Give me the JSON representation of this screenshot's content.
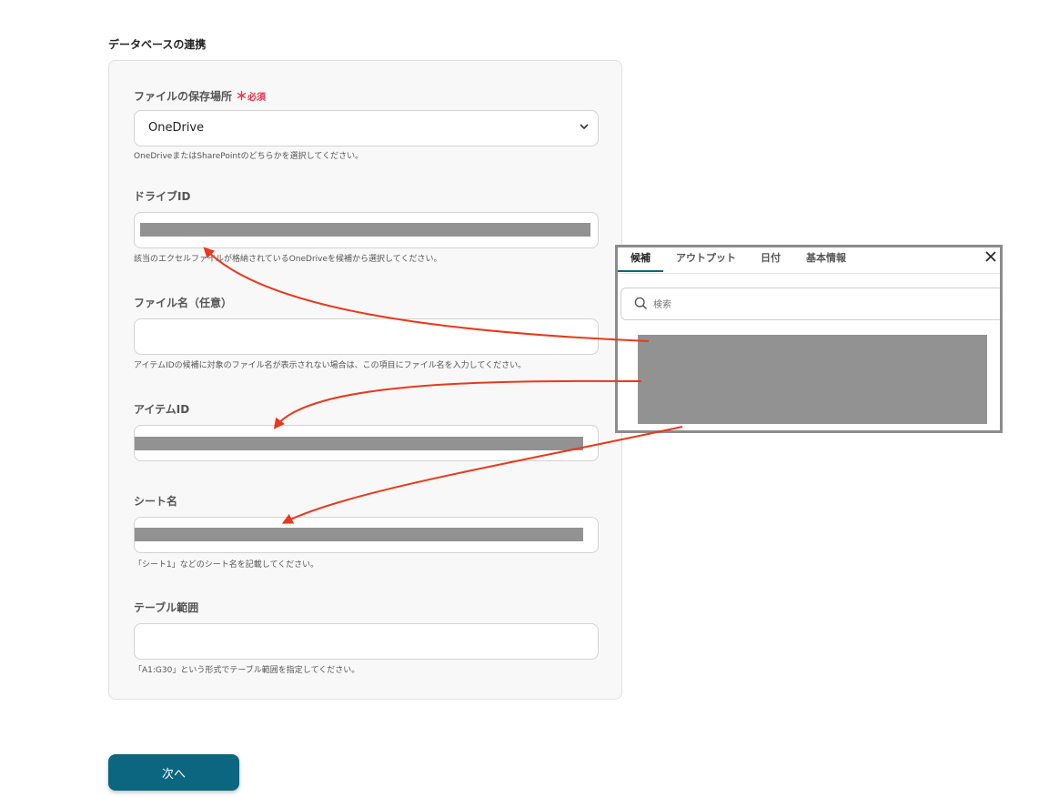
{
  "section_title": "データベースの連携",
  "fields": {
    "storage": {
      "label": "ファイルの保存場所",
      "required_mark": "＊",
      "required_text": "必須",
      "value": "OneDrive",
      "help": "OneDriveまたはSharePointのどちらかを選択してください。"
    },
    "drive_id": {
      "label": "ドライブID",
      "help": "該当のエクセルファイルが格納されているOneDriveを候補から選択してください。"
    },
    "file_name": {
      "label": "ファイル名（任意）",
      "help": "アイテムIDの候補に対象のファイル名が表示されない場合は、この項目にファイル名を入力してください。"
    },
    "item_id": {
      "label": "アイテムID"
    },
    "sheet_name": {
      "label": "シート名",
      "help": "「シート1」などのシート名を記載してください。"
    },
    "table_range": {
      "label": "テーブル範囲",
      "help": "「A1:G30」という形式でテーブル範囲を指定してください。"
    }
  },
  "next_button": "次へ",
  "popup": {
    "tabs": [
      "候補",
      "アウトプット",
      "日付",
      "基本情報"
    ],
    "active_tab": "候補",
    "search_placeholder": "検索"
  },
  "colors": {
    "primary": "#0d6680",
    "required": "#e8334a",
    "arrow": "#e8391c",
    "redaction": "#929292"
  }
}
